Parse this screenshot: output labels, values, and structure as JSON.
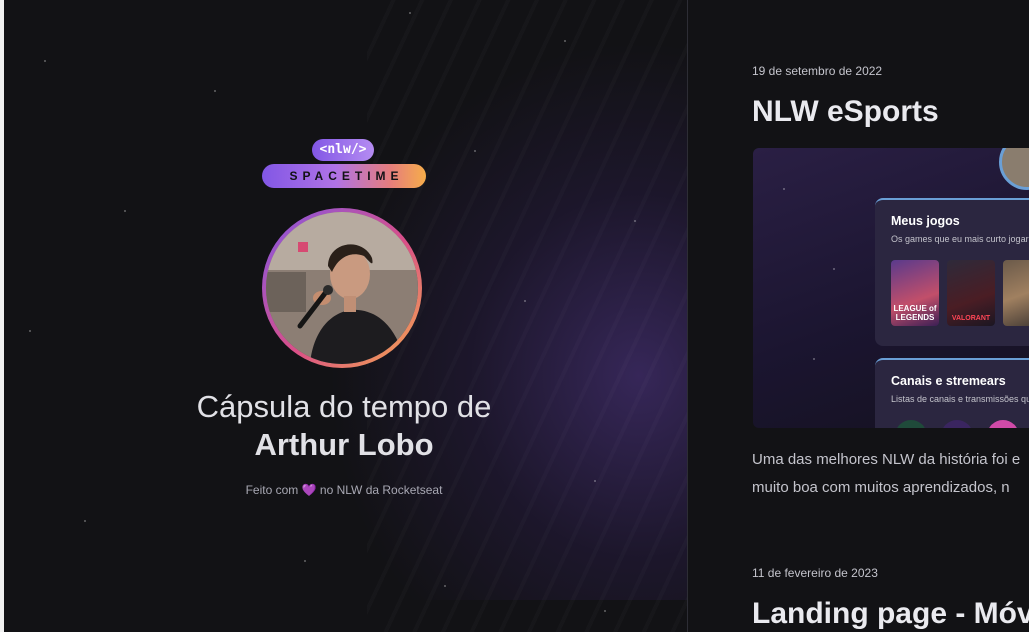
{
  "hero": {
    "logo_badge": "<nlw/>",
    "logo_text": "SPACETIME",
    "title_prefix": "Cápsula do tempo de",
    "user_name": "Arthur Lobo",
    "made_with_prefix": "Feito com",
    "made_with_heart": "💜",
    "made_with_suffix": "no NLW da Rocketseat"
  },
  "memories": [
    {
      "date": "19 de setembro de 2022",
      "title": "NLW eSports",
      "preview": {
        "card1_title": "Meus jogos",
        "card1_subtitle": "Os games que eu mais curto jogar",
        "game1_label": "LEAGUE of LEGENDS",
        "game2_label": "VALORANT",
        "card2_title": "Canais e stremears",
        "card2_subtitle": "Listas de canais e transmissões qu"
      },
      "excerpt_line1": "Uma das melhores NLW da história foi e",
      "excerpt_line2": "muito boa com muitos aprendizados, n"
    },
    {
      "date": "11 de fevereiro de 2023",
      "title": "Landing page - Móv"
    }
  ],
  "colors": {
    "background": "#121215",
    "accent_purple": "#8257e5",
    "accent_orange": "#f6ad4a",
    "text_primary": "#e1e1e6",
    "text_muted": "#a8a8b3"
  }
}
